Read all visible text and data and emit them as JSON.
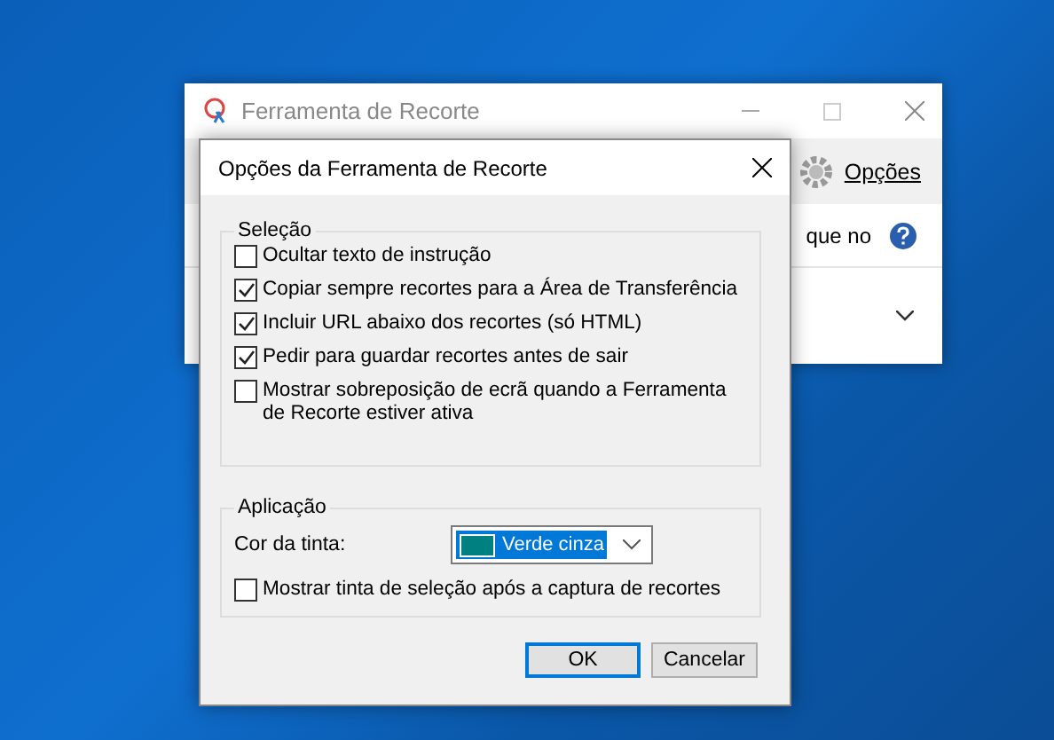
{
  "back_window": {
    "title": "Ferramenta de Recorte",
    "options_label": "Opções",
    "visible_text": "que no"
  },
  "dialog": {
    "title": "Opções da Ferramenta de Recorte",
    "selection_group": {
      "label": "Seleção",
      "options": [
        {
          "label": "Ocultar texto de instrução",
          "checked": false
        },
        {
          "label": "Copiar sempre recortes para a Área de Transferência",
          "checked": true
        },
        {
          "label": "Incluir URL abaixo dos recortes (só HTML)",
          "checked": true
        },
        {
          "label": "Pedir para guardar recortes antes de sair",
          "checked": true
        },
        {
          "label": "Mostrar sobreposição de ecrã quando a Ferramenta de Recorte estiver ativa",
          "checked": false
        }
      ]
    },
    "application_group": {
      "label": "Aplicação",
      "ink_label": "Cor da tinta:",
      "ink_value": "Verde cinza",
      "options": [
        {
          "label": "Mostrar tinta de seleção após a captura de recortes",
          "checked": false
        }
      ]
    },
    "buttons": [
      {
        "label": "OK",
        "selected": true
      },
      {
        "label": "Cancelar",
        "selected": false
      }
    ]
  }
}
